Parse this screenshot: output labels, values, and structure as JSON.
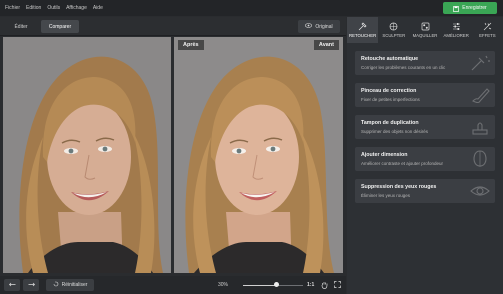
{
  "menu": [
    "Fichier",
    "Edition",
    "Outils",
    "Affichage",
    "Aide"
  ],
  "save_button": {
    "label": "Enregistrer",
    "icon": "save-icon",
    "color": "#3aa655"
  },
  "view_tabs": [
    {
      "label": "Éditer",
      "active": false
    },
    {
      "label": "Comparer",
      "active": true
    }
  ],
  "original_button": {
    "label": "Original",
    "icon": "eye-icon"
  },
  "photos": {
    "before_label": "Avant",
    "after_label": "Après"
  },
  "tool_tabs": [
    {
      "label": "RETOUCHER",
      "icon": "retouch-icon",
      "active": true
    },
    {
      "label": "SCULPTER",
      "icon": "sculpt-icon",
      "active": false
    },
    {
      "label": "MAQUILLER",
      "icon": "makeup-icon",
      "active": false
    },
    {
      "label": "AMÉLIORER",
      "icon": "sliders-icon",
      "active": false
    },
    {
      "label": "EFFETS",
      "icon": "effects-icon",
      "active": false
    }
  ],
  "tools": [
    {
      "title": "Retouche automatique",
      "subtitle": "Corriger les problèmes courants en un clic",
      "icon": "auto-retouch-icon"
    },
    {
      "title": "Pinceau de correction",
      "subtitle": "Fixer de petites imperfections",
      "icon": "brush-icon"
    },
    {
      "title": "Tampon de duplication",
      "subtitle": "Supprimer des objets non désirés",
      "icon": "clone-stamp-icon"
    },
    {
      "title": "Ajouter dimension",
      "subtitle": "Améliorer contraste et ajouter profondeur",
      "icon": "dimension-icon"
    },
    {
      "title": "Suppression des yeux rouges",
      "subtitle": "Éliminer les yeux rouges",
      "icon": "eye-icon"
    }
  ],
  "bottom": {
    "reset_label": "Réinitialiser",
    "zoom_label": "30%",
    "zoom_fraction": 0.55,
    "ratio_label": "1:1"
  }
}
